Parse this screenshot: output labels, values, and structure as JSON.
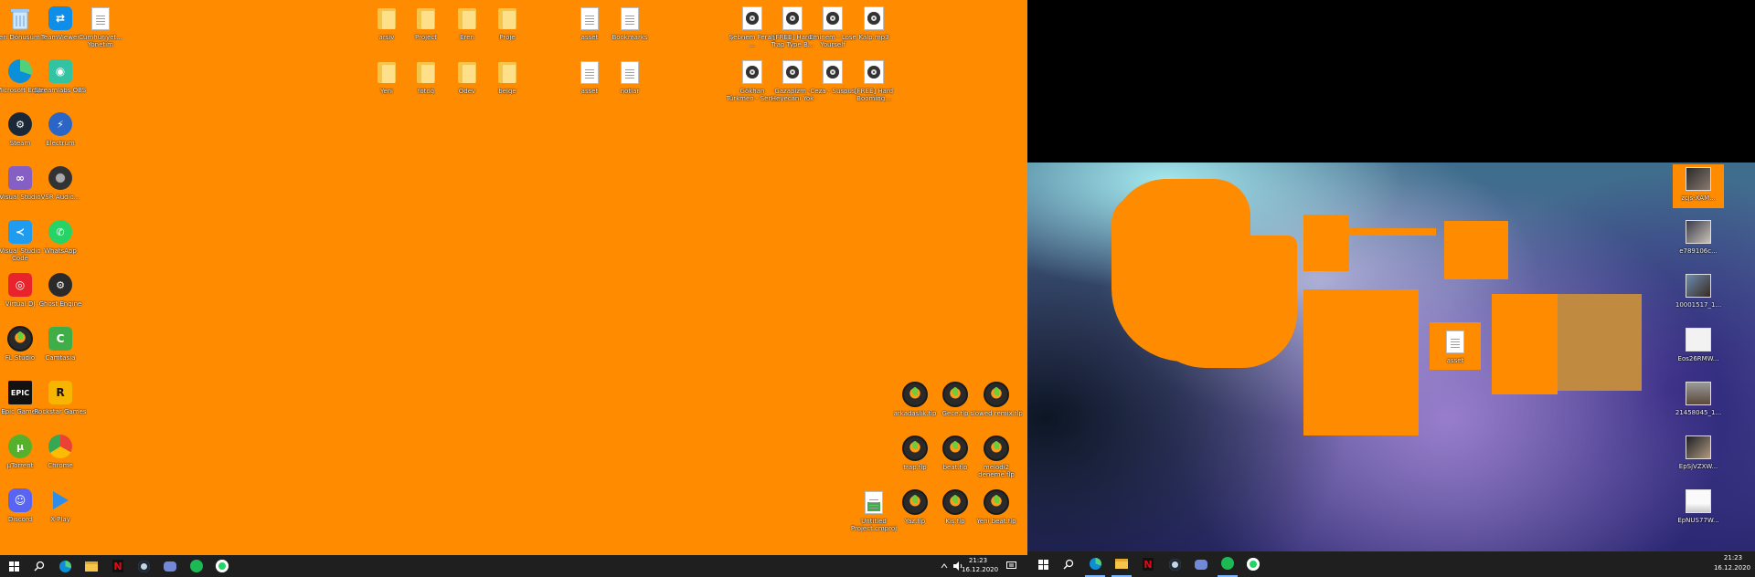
{
  "left_desktop": {
    "icons": [
      {
        "label": "Geri Dönüşüm...",
        "icon": "recycle-bin-icon",
        "color": "#6ec6ff"
      },
      {
        "label": "TeamViewer",
        "icon": "teamviewer-icon",
        "color": "#0e8ee9"
      },
      {
        "label": "Cumhuriyet... Yönetim",
        "icon": "document-icon",
        "color": "#ffffff"
      },
      {
        "label": "Microsoft Edge",
        "icon": "edge-icon",
        "color": "#0c8fd9"
      },
      {
        "label": "Streamlabs OBS",
        "icon": "streamlabs-icon",
        "color": "#31c3a2"
      },
      {
        "label": "Steam",
        "icon": "steam-icon",
        "color": "#1b2838"
      },
      {
        "label": "Electrum",
        "icon": "electrum-icon",
        "color": "#2b66c7"
      },
      {
        "label": "Visual Studio",
        "icon": "visual-studio-icon",
        "color": "#865fc5"
      },
      {
        "label": "VSR Audio...",
        "icon": "speaker-icon",
        "color": "#333333"
      },
      {
        "label": "Visual Studio Code",
        "icon": "vscode-icon",
        "color": "#1f9cf0"
      },
      {
        "label": "WhatsApp",
        "icon": "whatsapp-icon",
        "color": "#25d366"
      },
      {
        "label": "Virtual DJ",
        "icon": "virtualdj-icon",
        "color": "#e8232b"
      },
      {
        "label": "Ghost Engine",
        "icon": "gear-icon",
        "color": "#2a2a2a"
      },
      {
        "label": "FL Studio",
        "icon": "fl-studio-icon",
        "color": "#ff9c1a"
      },
      {
        "label": "Camtasia",
        "icon": "camtasia-icon",
        "color": "#3fae49"
      },
      {
        "label": "Epic Games",
        "icon": "epic-games-icon",
        "color": "#111111"
      },
      {
        "label": "Rockstar Games",
        "icon": "rockstar-icon",
        "color": "#f7b500"
      },
      {
        "label": "µTorrent",
        "icon": "utorrent-icon",
        "color": "#55b02c"
      },
      {
        "label": "Chrome",
        "icon": "chrome-icon",
        "color": "#4285f4"
      },
      {
        "label": "Discord",
        "icon": "discord-icon",
        "color": "#5865f2"
      },
      {
        "label": "X-Play",
        "icon": "play-icon",
        "color": "#2d8ee9"
      }
    ],
    "top_icons": [
      {
        "label": "arşiv",
        "icon": "folder-icon"
      },
      {
        "label": "Project",
        "icon": "folder-icon"
      },
      {
        "label": "Eren",
        "icon": "folder-icon"
      },
      {
        "label": "Proje",
        "icon": "folder-icon"
      },
      {
        "label": "Yeni",
        "icon": "folder-icon"
      },
      {
        "label": "fotoğ",
        "icon": "folder-icon"
      },
      {
        "label": "Ödev",
        "icon": "folder-icon"
      },
      {
        "label": "belge",
        "icon": "folder-icon"
      },
      {
        "label": "asset",
        "icon": "document-icon"
      },
      {
        "label": "Bookmarks",
        "icon": "document-icon"
      },
      {
        "label": "asset",
        "icon": "document-icon"
      },
      {
        "label": "notlar",
        "icon": "document-icon"
      }
    ],
    "audio_icons": [
      {
        "label": "Şebnem Ferah ...",
        "icon": "audio-file-icon"
      },
      {
        "label": "[FREE] Hard Trap Type B...",
        "icon": "audio-file-icon"
      },
      {
        "label": "Eminem - Lose Yourself",
        "icon": "audio-file-icon"
      },
      {
        "label": "Kalp.mp3",
        "icon": "audio-file-icon"
      },
      {
        "label": "Gökhan Türkmen - Sen...",
        "icon": "audio-file-icon"
      },
      {
        "label": "Gazapizm - Heyecanı Yok",
        "icon": "audio-file-icon"
      },
      {
        "label": "Ceza - Suspus",
        "icon": "audio-file-icon"
      },
      {
        "label": "[FREE] Hard Booming...",
        "icon": "audio-file-icon"
      }
    ],
    "flp_icons": [
      {
        "label": "arkadaşlık.flp",
        "icon": "fl-project-icon"
      },
      {
        "label": "Gece.flp",
        "icon": "fl-project-icon"
      },
      {
        "label": "slowed remix.flp",
        "icon": "fl-project-icon"
      },
      {
        "label": "trap.flp",
        "icon": "fl-project-icon"
      },
      {
        "label": "beat.flp",
        "icon": "fl-project-icon"
      },
      {
        "label": "melodi2 deneme.flp",
        "icon": "fl-project-icon"
      },
      {
        "label": "Untitled Project.cmproj",
        "icon": "camtasia-project-icon"
      },
      {
        "label": "Yaz.flp",
        "icon": "fl-project-icon"
      },
      {
        "label": "Kış.flp",
        "icon": "fl-project-icon"
      },
      {
        "label": "Yeni beat.flp",
        "icon": "fl-project-icon"
      }
    ]
  },
  "left_taskbar": {
    "clock_time": "21:23",
    "clock_date": "16.12.2020",
    "items": [
      "start-icon",
      "search-icon",
      "edge-icon",
      "file-explorer-icon",
      "netflix-icon",
      "steam-icon",
      "discord-icon",
      "spotify-icon",
      "whatsapp-icon"
    ]
  },
  "right_desktop": {
    "file_label": "asset",
    "icons": [
      {
        "label": "zcjs-XAM...",
        "icon": "photo-thumbnail-icon"
      },
      {
        "label": "e789106c...",
        "icon": "photo-thumbnail-icon"
      },
      {
        "label": "10001517_1...",
        "icon": "photo-thumbnail-icon"
      },
      {
        "label": "Eos26RMW...",
        "icon": "photo-thumbnail-icon"
      },
      {
        "label": "21458045_1...",
        "icon": "photo-thumbnail-icon"
      },
      {
        "label": "EpSjVZXW...",
        "icon": "photo-thumbnail-icon"
      },
      {
        "label": "EpNUS77W...",
        "icon": "photo-thumbnail-icon"
      }
    ]
  },
  "right_taskbar": {
    "clock_time": "21:23",
    "clock_date": "16.12.2020"
  },
  "colors": {
    "desktop_orange": "#ff8c00",
    "taskbar": "#1f1f1f",
    "accent_blend": "#c08a40"
  }
}
